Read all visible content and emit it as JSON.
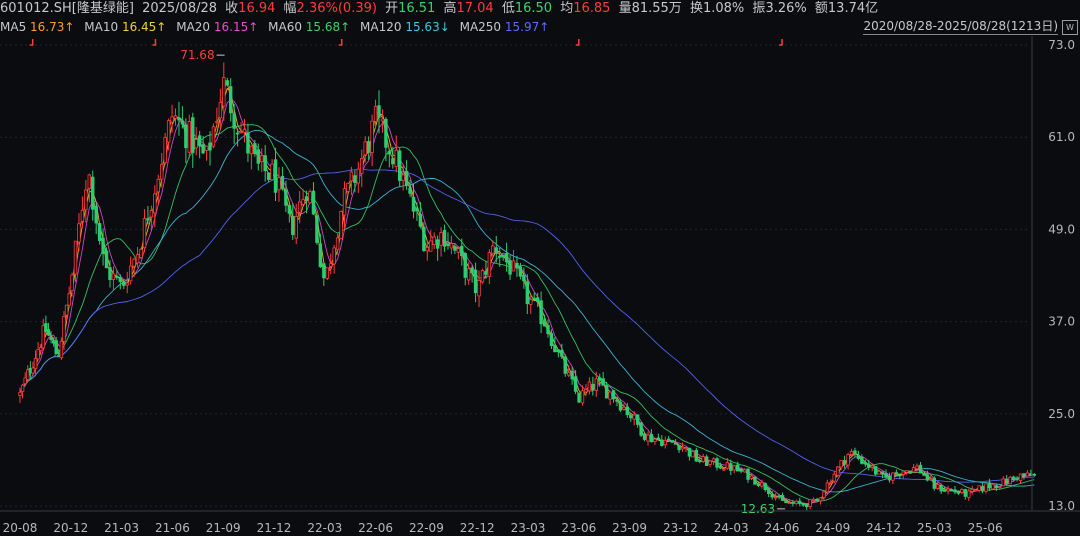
{
  "header": {
    "symbol": "601012.SH[隆基绿能]",
    "date": "2025/08/28",
    "close_label": "收",
    "close_value": "16.94",
    "change_label": "幅",
    "change_value": "2.36%(0.39)",
    "open_label": "开",
    "open_value": "16.51",
    "high_label": "高",
    "high_value": "17.04",
    "low_label": "低",
    "low_value": "16.50",
    "avg_label": "均",
    "avg_value": "16.85",
    "volume_label": "量",
    "volume_value": "81.55万",
    "turnover_label": "换",
    "turnover_value": "1.08%",
    "amplitude_label": "振",
    "amplitude_value": "3.26%",
    "amount_label": "额",
    "amount_value": "13.74亿"
  },
  "ma_bar": {
    "items": [
      {
        "label": "MA5",
        "value": "16.73↑",
        "color": "#ff9c2a"
      },
      {
        "label": "MA10",
        "value": "16.45↑",
        "color": "#f2d027"
      },
      {
        "label": "MA20",
        "value": "16.15↑",
        "color": "#e34fd6"
      },
      {
        "label": "MA60",
        "value": "15.68↑",
        "color": "#3cd26a"
      },
      {
        "label": "MA120",
        "value": "15.63↓",
        "color": "#3ec7e6"
      },
      {
        "label": "MA250",
        "value": "15.97↑",
        "color": "#5a6cff"
      }
    ],
    "range_text": "2020/08/28-2025/08/28(1213日)"
  },
  "chart_data": {
    "type": "candlestick",
    "x_ticks": [
      "20-08",
      "20-12",
      "21-03",
      "21-06",
      "21-09",
      "21-12",
      "22-03",
      "22-06",
      "22-09",
      "22-12",
      "23-03",
      "23-06",
      "23-09",
      "23-12",
      "24-03",
      "24-06",
      "24-09",
      "24-12",
      "25-03",
      "25-06"
    ],
    "y_ticks": [
      "73.0",
      "61.0",
      "49.0",
      "37.0",
      "25.0",
      "13.0"
    ],
    "ylim": [
      13.0,
      73.0
    ],
    "high_annotation": {
      "label": "71.68",
      "x": "21-09",
      "value": 71.68
    },
    "low_annotation": {
      "label": "12.63",
      "x": "24-06",
      "value": 12.63
    },
    "price_path": [
      [
        "20-08",
        27.5
      ],
      [
        "20-10",
        36.0
      ],
      [
        "20-11",
        32.5
      ],
      [
        "20-12",
        42.0
      ],
      [
        "21-01",
        57.0
      ],
      [
        "21-02",
        44.0
      ],
      [
        "21-03",
        41.5
      ],
      [
        "21-04",
        46.5
      ],
      [
        "21-05",
        55.0
      ],
      [
        "21-06",
        64.0
      ],
      [
        "21-07",
        61.0
      ],
      [
        "21-08",
        58.0
      ],
      [
        "21-09",
        68.0
      ],
      [
        "21-10",
        62.0
      ],
      [
        "21-11",
        57.0
      ],
      [
        "21-12",
        56.0
      ],
      [
        "22-01",
        49.0
      ],
      [
        "22-02",
        55.0
      ],
      [
        "22-03",
        42.0
      ],
      [
        "22-04",
        52.0
      ],
      [
        "22-05",
        57.0
      ],
      [
        "22-06",
        63.0
      ],
      [
        "22-07",
        59.0
      ],
      [
        "22-08",
        53.0
      ],
      [
        "22-09",
        47.0
      ],
      [
        "22-10",
        48.5
      ],
      [
        "22-11",
        45.0
      ],
      [
        "22-12",
        41.0
      ],
      [
        "23-01",
        47.0
      ],
      [
        "23-02",
        44.0
      ],
      [
        "23-03",
        40.0
      ],
      [
        "23-04",
        37.0
      ],
      [
        "23-05",
        31.5
      ],
      [
        "23-06",
        27.0
      ],
      [
        "23-07",
        29.0
      ],
      [
        "23-08",
        27.5
      ],
      [
        "23-09",
        25.0
      ],
      [
        "23-10",
        22.0
      ],
      [
        "23-11",
        21.5
      ],
      [
        "23-12",
        21.0
      ],
      [
        "24-01",
        19.0
      ],
      [
        "24-02",
        18.5
      ],
      [
        "24-03",
        18.0
      ],
      [
        "24-04",
        17.0
      ],
      [
        "24-05",
        15.5
      ],
      [
        "24-06",
        13.5
      ],
      [
        "24-07",
        13.2
      ],
      [
        "24-08",
        13.5
      ],
      [
        "24-09",
        17.0
      ],
      [
        "24-10",
        20.0
      ],
      [
        "24-11",
        18.5
      ],
      [
        "24-12",
        16.5
      ],
      [
        "25-01",
        17.5
      ],
      [
        "25-02",
        18.0
      ],
      [
        "25-03",
        15.5
      ],
      [
        "25-04",
        15.0
      ],
      [
        "25-05",
        14.5
      ],
      [
        "25-06",
        15.5
      ],
      [
        "25-07",
        16.0
      ],
      [
        "25-08",
        16.94
      ]
    ]
  }
}
